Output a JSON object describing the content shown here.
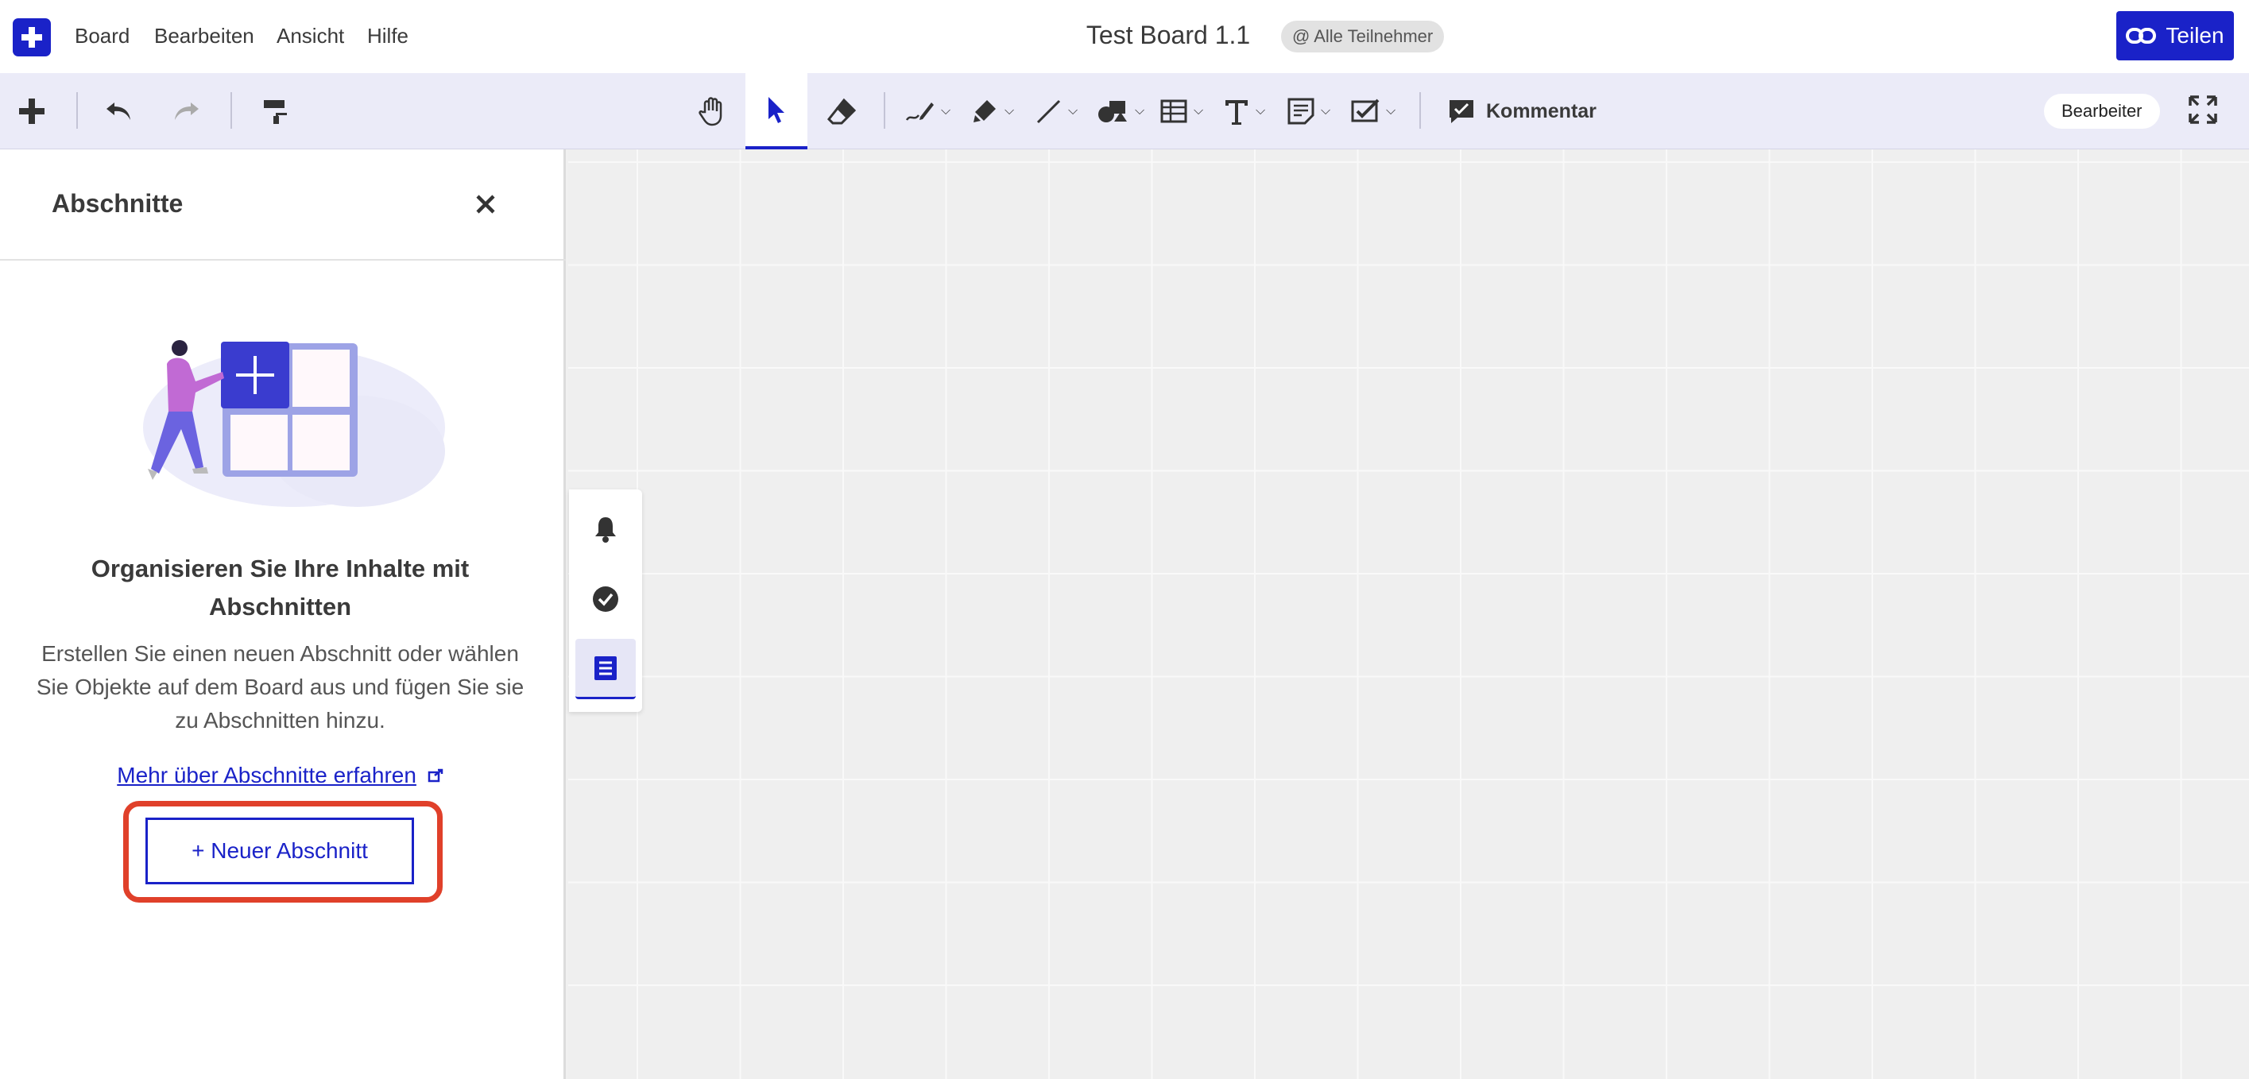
{
  "menu": {
    "items": [
      "Board",
      "Bearbeiten",
      "Ansicht",
      "Hilfe"
    ]
  },
  "header": {
    "title": "Test Board 1.1",
    "participants_badge": "@ Alle Teilnehmer",
    "share_label": "Teilen"
  },
  "toolbar": {
    "comment_label": "Kommentar",
    "role_label": "Bearbeiter",
    "tools": [
      "add",
      "undo",
      "redo",
      "format-painter",
      "hand",
      "select",
      "eraser",
      "pen",
      "highlighter",
      "line",
      "shapes",
      "table",
      "text",
      "sticky-note",
      "template"
    ]
  },
  "panel": {
    "title": "Abschnitte",
    "empty_heading": "Organisieren Sie Ihre Inhalte mit Abschnitten",
    "empty_body": "Erstellen Sie einen neuen Abschnitt oder wählen Sie Objekte auf dem Board aus und fügen Sie sie zu Abschnitten hinzu.",
    "learn_more_link": "Mehr über Abschnitte erfahren",
    "new_section_button": "+ Neuer Abschnitt"
  },
  "mini_toolbar": {
    "items": [
      "bell",
      "check-circle",
      "sections-list"
    ],
    "active": "sections-list"
  },
  "colors": {
    "accent": "#1a22c8",
    "highlight": "#e0402a",
    "toolbar_bg": "#ebebf8",
    "canvas_bg": "#efefef"
  }
}
